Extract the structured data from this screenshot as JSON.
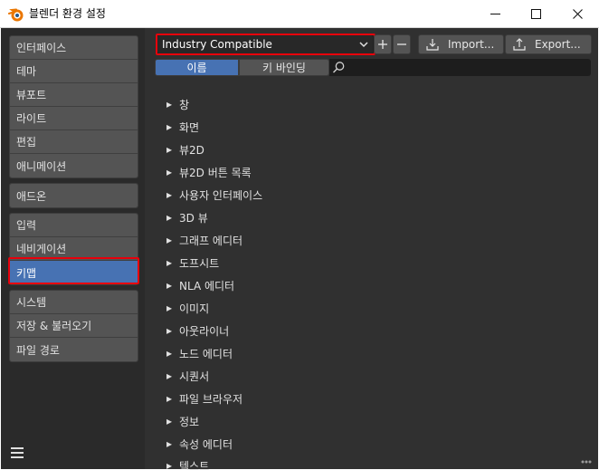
{
  "window": {
    "title": "블렌더 환경 설정",
    "controls": {
      "minimize": "minimize",
      "maximize": "maximize",
      "close": "close"
    }
  },
  "sidebar": {
    "groups": [
      {
        "items": [
          {
            "label": "인터페이스"
          },
          {
            "label": "테마"
          },
          {
            "label": "뷰포트"
          },
          {
            "label": "라이트"
          },
          {
            "label": "편집"
          },
          {
            "label": "애니메이션"
          }
        ]
      },
      {
        "items": [
          {
            "label": "애드온"
          }
        ]
      },
      {
        "items": [
          {
            "label": "입력"
          },
          {
            "label": "네비게이션"
          },
          {
            "label": "키맵",
            "active": true
          }
        ]
      },
      {
        "items": [
          {
            "label": "시스템"
          },
          {
            "label": "저장 & 불러오기"
          },
          {
            "label": "파일 경로"
          }
        ]
      }
    ]
  },
  "toolbar": {
    "preset_value": "Industry Compatible",
    "add_icon": "plus-icon",
    "remove_icon": "minus-icon",
    "import_label": "Import...",
    "export_label": "Export..."
  },
  "filter": {
    "mode_name": "이름",
    "mode_keybinding": "키 바인딩",
    "active_mode": "이름",
    "search_value": ""
  },
  "keymap_tree": [
    "창",
    "화면",
    "뷰2D",
    "뷰2D 버튼 목록",
    "사용자 인터페이스",
    "3D 뷰",
    "그래프 에디터",
    "도프시트",
    "NLA 에디터",
    "이미지",
    "아웃라이너",
    "노드 에디터",
    "시퀀서",
    "파일 브라우저",
    "정보",
    "속성 에디터",
    "텍스트"
  ],
  "colors": {
    "accent": "#4772b3",
    "highlight_outline": "#e8000b",
    "panel_bg": "#303030",
    "sidebar_bg": "#2a2a2a",
    "button_bg": "#545454"
  }
}
